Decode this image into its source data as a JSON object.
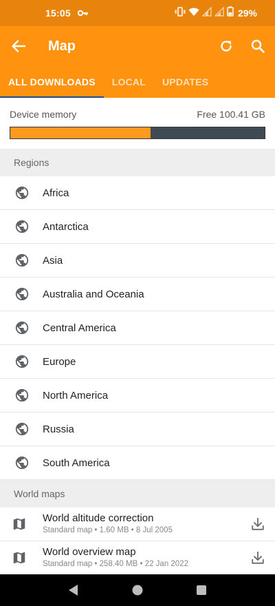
{
  "status_bar": {
    "time": "15:05",
    "battery": "29%"
  },
  "app_bar": {
    "title": "Map"
  },
  "tabs": [
    {
      "label": "ALL DOWNLOADS",
      "active": true
    },
    {
      "label": "LOCAL",
      "active": false
    },
    {
      "label": "UPDATES",
      "active": false
    }
  ],
  "memory": {
    "label": "Device memory",
    "free": "Free 100.41 GB",
    "used_fraction": 0.55
  },
  "regions": {
    "header": "Regions",
    "items": [
      "Africa",
      "Antarctica",
      "Asia",
      "Australia and Oceania",
      "Central America",
      "Europe",
      "North America",
      "Russia",
      "South America"
    ]
  },
  "world_maps": {
    "header": "World maps",
    "items": [
      {
        "name": "World altitude correction",
        "meta": "Standard map • 1.60 MB • 8 Jul 2005"
      },
      {
        "name": "World overview map",
        "meta": "Standard map • 258.40 MB • 22 Jan 2022"
      }
    ]
  },
  "colors": {
    "status_bar": "#e8840c",
    "app_bar": "#ff9310",
    "tab_indicator": "#1f4b8e",
    "memory_used": "#ff9a1f",
    "memory_free": "#3f4a52"
  }
}
